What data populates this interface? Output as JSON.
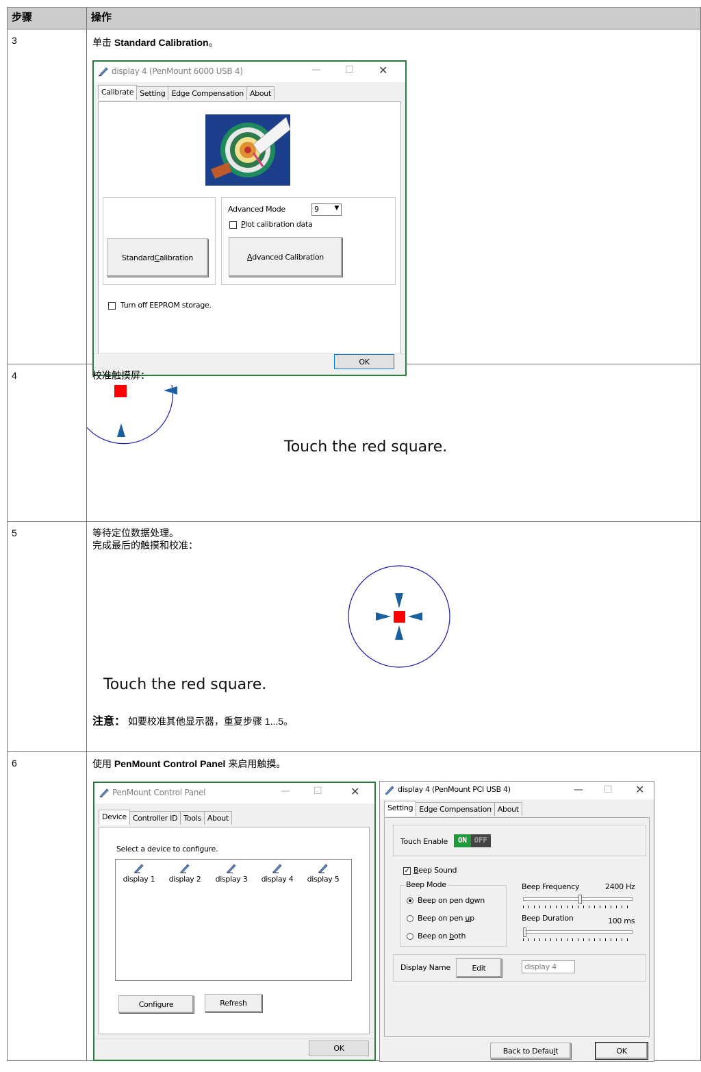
{
  "table": {
    "headers": [
      "步骤",
      "操作"
    ]
  },
  "rows": [
    {
      "step": "3",
      "instruction_prefix": "单击 ",
      "instruction_bold": "Standard Calibration",
      "instruction_suffix": "。"
    },
    {
      "step": "4",
      "instruction": "校准触摸屏：",
      "touch_text": "Touch the red square."
    },
    {
      "step": "5",
      "line1": "等待定位数据处理。",
      "line2": "完成最后的触摸和校准：",
      "touch_text": "Touch the red square.",
      "note_label": "注意：",
      "note_text": " 如要校准其他显示器，重复步骤 1...5。"
    },
    {
      "step": "6",
      "instruction_prefix": "使用 ",
      "instruction_bold": "PenMount Control Panel",
      "instruction_suffix": " 来启用触摸。"
    }
  ],
  "calib_dialog": {
    "title": "display 4 (PenMount 6000 USB 4)",
    "tabs": [
      "Calibrate",
      "Setting",
      "Edge Compensation",
      "About"
    ],
    "advanced_mode_label": "Advanced Mode",
    "advanced_mode_value": "9",
    "plot_label_u": "P",
    "plot_label_rest": "lot calibration data",
    "standard_btn_pre": "Standard ",
    "standard_btn_u": "C",
    "standard_btn_post": "alibration",
    "advanced_btn_u": "A",
    "advanced_btn_post": "dvanced Calibration",
    "eeprom_label": "Turn off EEPROM storage.",
    "ok": "OK"
  },
  "control_panel": {
    "title": "PenMount Control Panel",
    "tabs": [
      "Device",
      "Controller ID",
      "Tools",
      "About"
    ],
    "select_label": "Select a device to configure.",
    "devices": [
      "display 1",
      "display 2",
      "display 3",
      "display 4",
      "display 5"
    ],
    "configure": "Configure",
    "refresh": "Refresh",
    "ok": "OK"
  },
  "settings_dialog": {
    "title": "display 4 (PenMount PCI USB 4)",
    "tabs": [
      "Setting",
      "Edge Compensation",
      "About"
    ],
    "touch_enable": "Touch Enable",
    "switch_on": "ON",
    "switch_off": "OFF",
    "beep_sound_u": "B",
    "beep_sound_rest": "eep Sound",
    "beep_mode": "Beep Mode",
    "beep_down_pre": "Beep on pen d",
    "beep_down_u": "o",
    "beep_down_post": "wn",
    "beep_up_pre": "Beep on pen ",
    "beep_up_u": "u",
    "beep_up_post": "p",
    "beep_both_pre": "Beep on ",
    "beep_both_u": "b",
    "beep_both_post": "oth",
    "beep_frequency": "Beep Frequency",
    "frequency_value": "2400 Hz",
    "frequency_fraction": 0.52,
    "beep_duration": "Beep Duration",
    "duration_value": "100  ms",
    "duration_fraction": 0.0,
    "display_name": "Display Name",
    "edit": "Edit",
    "display_name_value": "display 4",
    "back_pre": "Back to Defau",
    "back_u": "l",
    "back_post": "t",
    "ok": "OK"
  },
  "colors": {
    "header_bg": "#cccccc",
    "dialog_border": "#2a7a3a",
    "target_red": "#ff0000",
    "arrow_blue": "#1a5f9e",
    "switch_on": "#1f9a3a"
  }
}
